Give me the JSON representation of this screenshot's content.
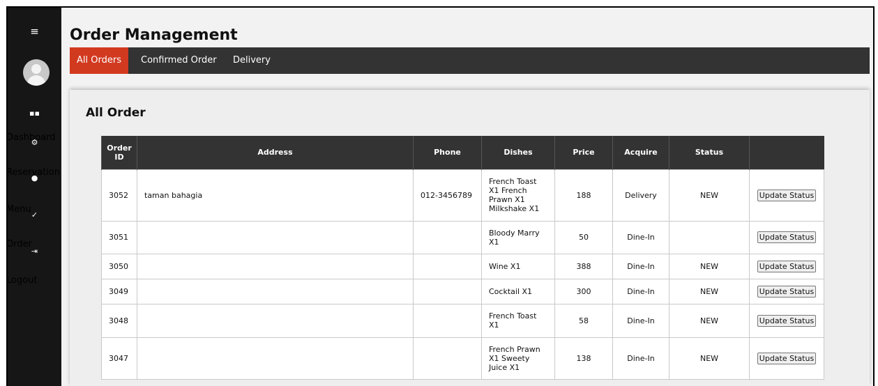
{
  "sidebar": {
    "menu_icon": "≡",
    "nav": [
      {
        "icon": "▪▪",
        "label": "Dashboard"
      },
      {
        "icon": "⚙",
        "label": "Reservation"
      },
      {
        "icon": "●",
        "label": "Menu"
      },
      {
        "icon": "✓",
        "label": "Order"
      },
      {
        "icon": "⇥",
        "label": "Logout"
      }
    ]
  },
  "header": {
    "title": "Order Management",
    "tabs": [
      {
        "label": "All Orders",
        "active": true
      },
      {
        "label": "Confirmed Order",
        "active": false
      },
      {
        "label": "Delivery",
        "active": false
      }
    ]
  },
  "card": {
    "title": "All Order"
  },
  "table": {
    "columns": [
      "Order ID",
      "Address",
      "Phone",
      "Dishes",
      "Price",
      "Acquire",
      "Status",
      ""
    ],
    "rows": [
      {
        "id": "3052",
        "address": "taman bahagia",
        "phone": "012-3456789",
        "dishes": "French Toast X1 French Prawn X1 Milkshake X1",
        "price": "188",
        "acquire": "Delivery",
        "status": "NEW",
        "action": "Update Status"
      },
      {
        "id": "3051",
        "address": "",
        "phone": "",
        "dishes": "Bloody Marry X1",
        "price": "50",
        "acquire": "Dine-In",
        "status": "",
        "action": "Update Status"
      },
      {
        "id": "3050",
        "address": "",
        "phone": "",
        "dishes": "Wine X1",
        "price": "388",
        "acquire": "Dine-In",
        "status": "NEW",
        "action": "Update Status"
      },
      {
        "id": "3049",
        "address": "",
        "phone": "",
        "dishes": "Cocktail X1",
        "price": "300",
        "acquire": "Dine-In",
        "status": "NEW",
        "action": "Update Status"
      },
      {
        "id": "3048",
        "address": "",
        "phone": "",
        "dishes": "French Toast X1",
        "price": "58",
        "acquire": "Dine-In",
        "status": "NEW",
        "action": "Update Status"
      },
      {
        "id": "3047",
        "address": "",
        "phone": "",
        "dishes": "French Prawn X1 Sweety Juice X1",
        "price": "138",
        "acquire": "Dine-In",
        "status": "NEW",
        "action": "Update Status"
      }
    ]
  },
  "colors": {
    "accent": "#d23a20",
    "sidebar": "#161616",
    "tabbar": "#333333",
    "header_row": "#333333"
  }
}
